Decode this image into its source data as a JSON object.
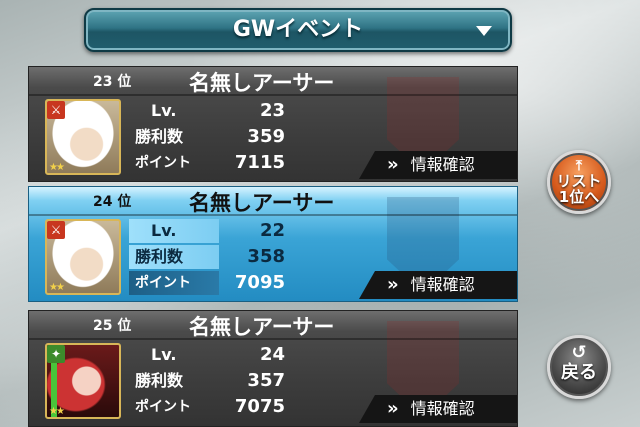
{
  "header": {
    "title": "GWイベント"
  },
  "rows": [
    {
      "rank": "23 位",
      "name": "名無しアーサー",
      "lv_label": "Lv.",
      "lv": "23",
      "wins_label": "勝利数",
      "wins": "359",
      "points_label": "ポイント",
      "points": "7115",
      "info_label": "情報確認",
      "chevron": "»"
    },
    {
      "rank": "24 位",
      "name": "名無しアーサー",
      "lv_label": "Lv.",
      "lv": "22",
      "wins_label": "勝利数",
      "wins": "358",
      "points_label": "ポイント",
      "points": "7095",
      "info_label": "情報確認",
      "chevron": "»"
    },
    {
      "rank": "25 位",
      "name": "名無しアーサー",
      "lv_label": "Lv.",
      "lv": "24",
      "wins_label": "勝利数",
      "wins": "357",
      "points_label": "ポイント",
      "points": "7075",
      "info_label": "情報確認",
      "chevron": "»"
    }
  ],
  "side": {
    "top_label_1": "リスト",
    "top_label_2": "1位へ",
    "back_label": "戻る"
  },
  "icons": {
    "dropdown": "triangle-down",
    "top": "arrow-up-to-top",
    "back": "return-arrow"
  }
}
